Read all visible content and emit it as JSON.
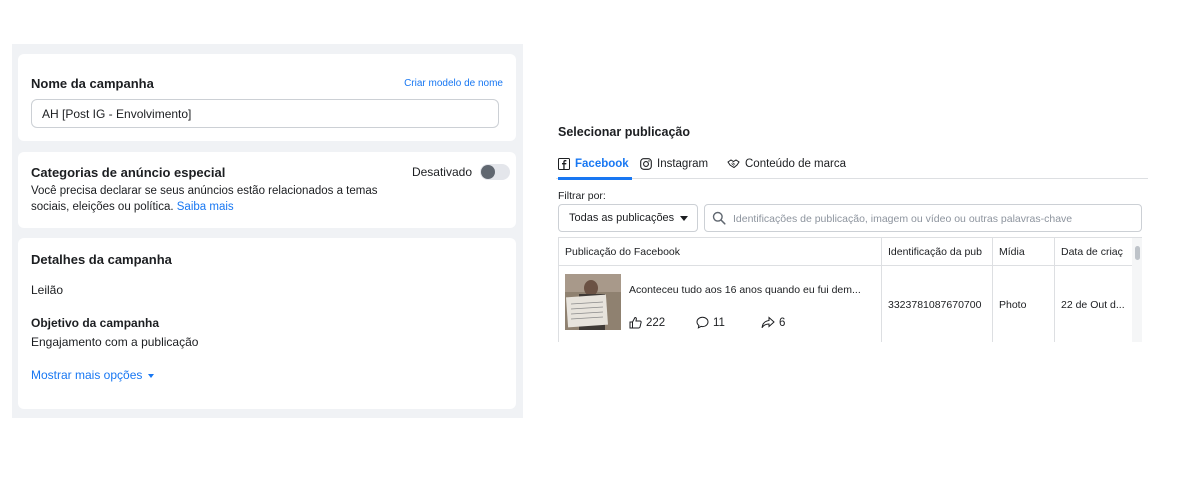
{
  "campaign_name": {
    "heading": "Nome da campanha",
    "create_template_link": "Criar modelo de nome",
    "value": "AH [Post IG - Envolvimento]"
  },
  "special_categories": {
    "heading": "Categorias de anúncio especial",
    "description": "Você precisa declarar se seus anúncios estão relacionados a temas sociais, eleições ou política.",
    "learn_more": "Saiba mais",
    "toggle_label": "Desativado",
    "toggle_on": false
  },
  "campaign_details": {
    "heading": "Detalhes da campanha",
    "buying_type": "Leilão",
    "objective_label": "Objetivo da campanha",
    "objective_value": "Engajamento com a publicação",
    "more_options": "Mostrar mais opções"
  },
  "select_post": {
    "title": "Selecionar publicação",
    "tabs": [
      {
        "label": "Facebook",
        "icon": "facebook-icon",
        "active": true
      },
      {
        "label": "Instagram",
        "icon": "instagram-icon",
        "active": false
      },
      {
        "label": "Conteúdo de marca",
        "icon": "handshake-icon",
        "active": false
      }
    ],
    "filter_label": "Filtrar por:",
    "filter_dropdown": "Todas as publicações",
    "search_placeholder": "Identificações de publicação, imagem ou vídeo ou outras palavras-chave",
    "columns": [
      "Publicação do Facebook",
      "Identificação da pub",
      "Mídia",
      "Data de criaç"
    ],
    "rows": [
      {
        "text": "Aconteceu tudo aos 16 anos quando eu fui dem...",
        "likes": "222",
        "comments": "11",
        "shares": "6",
        "id": "3323781087670700",
        "media": "Photo",
        "date": "22 de Out d..."
      }
    ]
  },
  "colors": {
    "accent": "#1877f2",
    "panel_bg": "#f0f2f5"
  }
}
